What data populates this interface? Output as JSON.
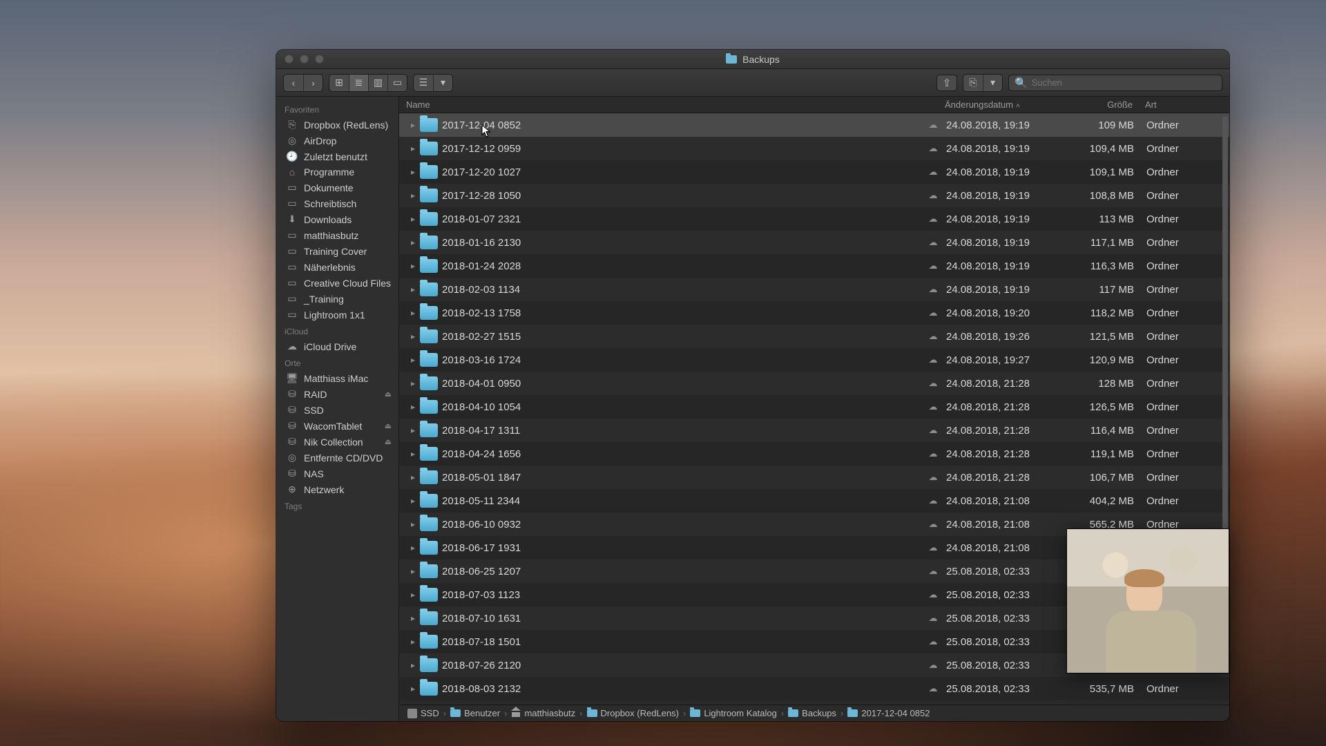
{
  "window": {
    "title": "Backups"
  },
  "search": {
    "placeholder": "Suchen"
  },
  "columns": {
    "name": "Name",
    "mod": "Änderungsdatum",
    "size": "Größe",
    "kind": "Art",
    "sort_indicator": "˄"
  },
  "sidebar": {
    "favorites_label": "Favoriten",
    "favorites": [
      {
        "icon": "⎘",
        "label": "Dropbox (RedLens)"
      },
      {
        "icon": "◎",
        "label": "AirDrop"
      },
      {
        "icon": "🕘",
        "label": "Zuletzt benutzt"
      },
      {
        "icon": "⌂",
        "label": "Programme"
      },
      {
        "icon": "▭",
        "label": "Dokumente"
      },
      {
        "icon": "▭",
        "label": "Schreibtisch"
      },
      {
        "icon": "⬇",
        "label": "Downloads"
      },
      {
        "icon": "▭",
        "label": "matthiasbutz"
      },
      {
        "icon": "▭",
        "label": "Training Cover"
      },
      {
        "icon": "▭",
        "label": "Näherlebnis"
      },
      {
        "icon": "▭",
        "label": "Creative Cloud Files"
      },
      {
        "icon": "▭",
        "label": "_Training"
      },
      {
        "icon": "▭",
        "label": "Lightroom 1x1"
      }
    ],
    "icloud_label": "iCloud",
    "icloud": [
      {
        "icon": "☁",
        "label": "iCloud Drive"
      }
    ],
    "locations_label": "Orte",
    "locations": [
      {
        "icon": "🖥",
        "label": "Matthiass iMac",
        "eject": false
      },
      {
        "icon": "⛁",
        "label": "RAID",
        "eject": true
      },
      {
        "icon": "⛁",
        "label": "SSD",
        "eject": false
      },
      {
        "icon": "⛁",
        "label": "WacomTablet",
        "eject": true
      },
      {
        "icon": "⛁",
        "label": "Nik Collection",
        "eject": true
      },
      {
        "icon": "◎",
        "label": "Entfernte CD/DVD",
        "eject": false
      },
      {
        "icon": "⛁",
        "label": "NAS",
        "eject": false
      },
      {
        "icon": "⊕",
        "label": "Netzwerk",
        "eject": false
      }
    ],
    "tags_label": "Tags"
  },
  "rows": [
    {
      "name": "2017-12-04 0852",
      "mod": "24.08.2018, 19:19",
      "size": "109 MB",
      "kind": "Ordner",
      "selected": true
    },
    {
      "name": "2017-12-12 0959",
      "mod": "24.08.2018, 19:19",
      "size": "109,4 MB",
      "kind": "Ordner"
    },
    {
      "name": "2017-12-20 1027",
      "mod": "24.08.2018, 19:19",
      "size": "109,1 MB",
      "kind": "Ordner"
    },
    {
      "name": "2017-12-28 1050",
      "mod": "24.08.2018, 19:19",
      "size": "108,8 MB",
      "kind": "Ordner"
    },
    {
      "name": "2018-01-07 2321",
      "mod": "24.08.2018, 19:19",
      "size": "113 MB",
      "kind": "Ordner"
    },
    {
      "name": "2018-01-16 2130",
      "mod": "24.08.2018, 19:19",
      "size": "117,1 MB",
      "kind": "Ordner"
    },
    {
      "name": "2018-01-24 2028",
      "mod": "24.08.2018, 19:19",
      "size": "116,3 MB",
      "kind": "Ordner"
    },
    {
      "name": "2018-02-03 1134",
      "mod": "24.08.2018, 19:19",
      "size": "117 MB",
      "kind": "Ordner"
    },
    {
      "name": "2018-02-13 1758",
      "mod": "24.08.2018, 19:20",
      "size": "118,2 MB",
      "kind": "Ordner"
    },
    {
      "name": "2018-02-27 1515",
      "mod": "24.08.2018, 19:26",
      "size": "121,5 MB",
      "kind": "Ordner"
    },
    {
      "name": "2018-03-16 1724",
      "mod": "24.08.2018, 19:27",
      "size": "120,9 MB",
      "kind": "Ordner"
    },
    {
      "name": "2018-04-01 0950",
      "mod": "24.08.2018, 21:28",
      "size": "128 MB",
      "kind": "Ordner"
    },
    {
      "name": "2018-04-10 1054",
      "mod": "24.08.2018, 21:28",
      "size": "126,5 MB",
      "kind": "Ordner"
    },
    {
      "name": "2018-04-17 1311",
      "mod": "24.08.2018, 21:28",
      "size": "116,4 MB",
      "kind": "Ordner"
    },
    {
      "name": "2018-04-24 1656",
      "mod": "24.08.2018, 21:28",
      "size": "119,1 MB",
      "kind": "Ordner"
    },
    {
      "name": "2018-05-01 1847",
      "mod": "24.08.2018, 21:28",
      "size": "106,7 MB",
      "kind": "Ordner"
    },
    {
      "name": "2018-05-11 2344",
      "mod": "24.08.2018, 21:08",
      "size": "404,2 MB",
      "kind": "Ordner"
    },
    {
      "name": "2018-06-10 0932",
      "mod": "24.08.2018, 21:08",
      "size": "565,2 MB",
      "kind": "Ordner"
    },
    {
      "name": "2018-06-17 1931",
      "mod": "24.08.2018, 21:08",
      "size": "",
      "kind": ""
    },
    {
      "name": "2018-06-25 1207",
      "mod": "25.08.2018, 02:33",
      "size": "",
      "kind": ""
    },
    {
      "name": "2018-07-03 1123",
      "mod": "25.08.2018, 02:33",
      "size": "",
      "kind": ""
    },
    {
      "name": "2018-07-10 1631",
      "mod": "25.08.2018, 02:33",
      "size": "",
      "kind": ""
    },
    {
      "name": "2018-07-18 1501",
      "mod": "25.08.2018, 02:33",
      "size": "",
      "kind": ""
    },
    {
      "name": "2018-07-26 2120",
      "mod": "25.08.2018, 02:33",
      "size": "",
      "kind": ""
    },
    {
      "name": "2018-08-03 2132",
      "mod": "25.08.2018, 02:33",
      "size": "535,7 MB",
      "kind": "Ordner"
    }
  ],
  "path": [
    {
      "type": "disk",
      "label": "SSD"
    },
    {
      "type": "folder",
      "label": "Benutzer"
    },
    {
      "type": "home",
      "label": "matthiasbutz"
    },
    {
      "type": "folder",
      "label": "Dropbox (RedLens)"
    },
    {
      "type": "folder",
      "label": "Lightroom Katalog"
    },
    {
      "type": "folder",
      "label": "Backups"
    },
    {
      "type": "folder",
      "label": "2017-12-04 0852"
    }
  ],
  "cloud_glyph": "☁",
  "chevron": "›",
  "disclose": "▸",
  "eject_glyph": "⏏"
}
